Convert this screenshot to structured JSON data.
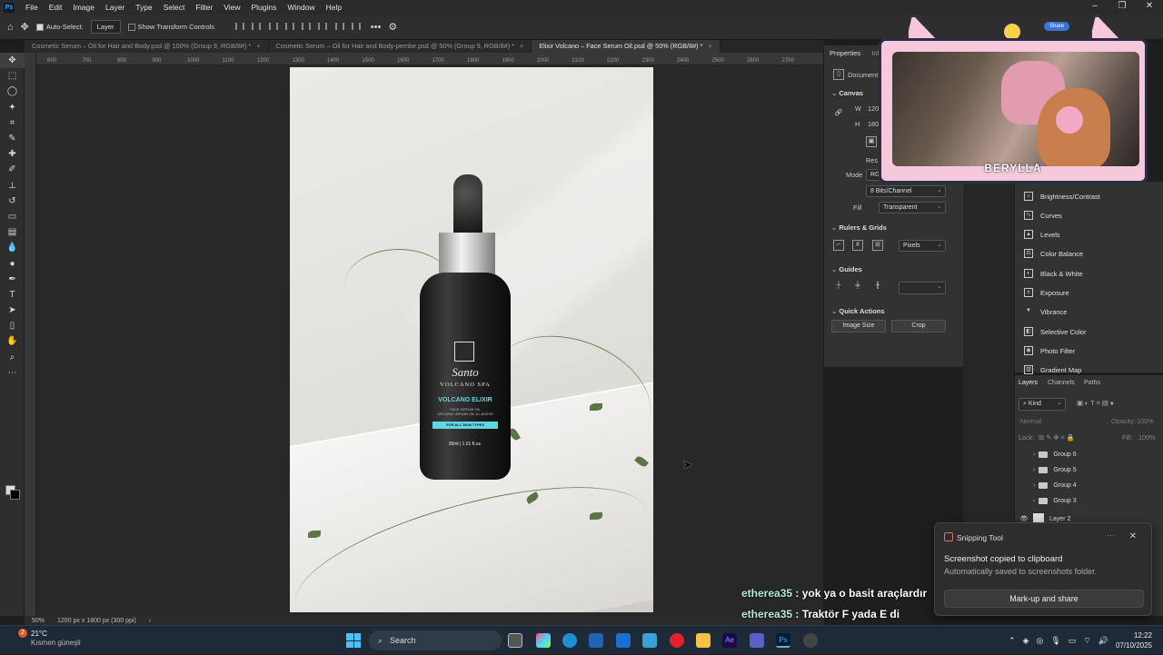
{
  "menubar": {
    "logo": "Ps",
    "items": [
      "File",
      "Edit",
      "Image",
      "Layer",
      "Type",
      "Select",
      "Filter",
      "View",
      "Plugins",
      "Window",
      "Help"
    ]
  },
  "options": {
    "auto_select_label": "Auto-Select:",
    "auto_select_checked": true,
    "layer_select_value": "Layer",
    "transform_label": "Show Transform Controls",
    "more": "•••"
  },
  "tabs": [
    {
      "label": "Cosmetic Serum – Oil for Hair and Body.psd @ 100% (Group 9, RGB/8#) *",
      "active": false
    },
    {
      "label": "Cosmetic Serum – Oil for Hair and Body-pembe.psd @ 50% (Group 9, RGB/8#) *",
      "active": false
    },
    {
      "label": "Elixir Volcano – Face Serum Oil.psd @ 50% (RGB/8#) *",
      "active": true
    }
  ],
  "ruler": {
    "ticks": [
      "600",
      "700",
      "800",
      "900",
      "1000",
      "1100",
      "1200",
      "1300",
      "1400",
      "1500",
      "1600",
      "1700",
      "1800",
      "1900",
      "2000",
      "2100",
      "2200",
      "2300",
      "2400",
      "2500",
      "2600",
      "2700"
    ]
  },
  "product": {
    "brand": "Santo",
    "sub": "VOLCANO SPA",
    "name": "VOLCANO ELIXIR",
    "desc1": "FACE SERUM OIL",
    "desc2": "ORGANIC ARGAN OIL & LAVESS",
    "badge": "FOR ALL SKIN TYPES",
    "volume": "30ml | 1.01 fl.oz."
  },
  "status": {
    "zoom": "50%",
    "doc_info": "1200 px x 1800 px (300 ppi)"
  },
  "properties": {
    "tab_properties": "Properties",
    "tab_info": "Inf",
    "document_label": "Document",
    "canvas_head": "Canvas",
    "w_label": "W",
    "w_value": "120",
    "h_label": "H",
    "h_value": "180",
    "res_label": "Res",
    "mode_label": "Mode",
    "mode_value": "RGB",
    "bits_value": "8 Bits/Channel",
    "fill_label": "Fill",
    "fill_value": "Transparent",
    "rulers_head": "Rulers & Grids",
    "units_value": "Pixels",
    "guides_head": "Guides",
    "qa_head": "Quick Actions",
    "image_size_btn": "Image Size",
    "crop_btn": "Crop"
  },
  "adjustments": [
    "Brightness/Contrast",
    "Curves",
    "Levels",
    "Color Balance",
    "Black & White",
    "Exposure",
    "Vibrance",
    "Selective Color",
    "Photo Filter",
    "Gradient Map"
  ],
  "layers_panel": {
    "tabs": [
      "Layers",
      "Channels",
      "Paths"
    ],
    "kind_label": "Kind",
    "blend_value": "Normal",
    "opacity_label": "Opacity:",
    "opacity_value": "100%",
    "lock_label": "Lock:",
    "fill_label": "Fill:",
    "fill_value": "100%",
    "layers": [
      {
        "name": "Group 6",
        "type": "group"
      },
      {
        "name": "Group 5",
        "type": "group"
      },
      {
        "name": "Group 4",
        "type": "group"
      },
      {
        "name": "Group 3",
        "type": "group"
      },
      {
        "name": "Layer 2",
        "type": "layer"
      }
    ]
  },
  "webcam": {
    "name": "BERYLLA",
    "share_label": "Share"
  },
  "chat": [
    {
      "user": "etherea35",
      "text": " : yok ya o basit araçlardır"
    },
    {
      "user": "etherea35",
      "text": " : Traktör F yada E di"
    }
  ],
  "toast": {
    "title": "Snipping Tool",
    "message": "Screenshot copied to clipboard",
    "sub": "Automatically saved to screenshots folder.",
    "action": "Mark-up and share",
    "more": "···",
    "close": "✕"
  },
  "taskbar": {
    "weather_badge": "2",
    "temp": "21°C",
    "condition": "Kısmen güneşli",
    "search_placeholder": "Search",
    "time": "12:22",
    "date": "07/10/2025"
  },
  "colors": {
    "accent": "#31a8ff",
    "label_teal": "#5fd7de",
    "webcam_pink": "#f5c8dc"
  }
}
